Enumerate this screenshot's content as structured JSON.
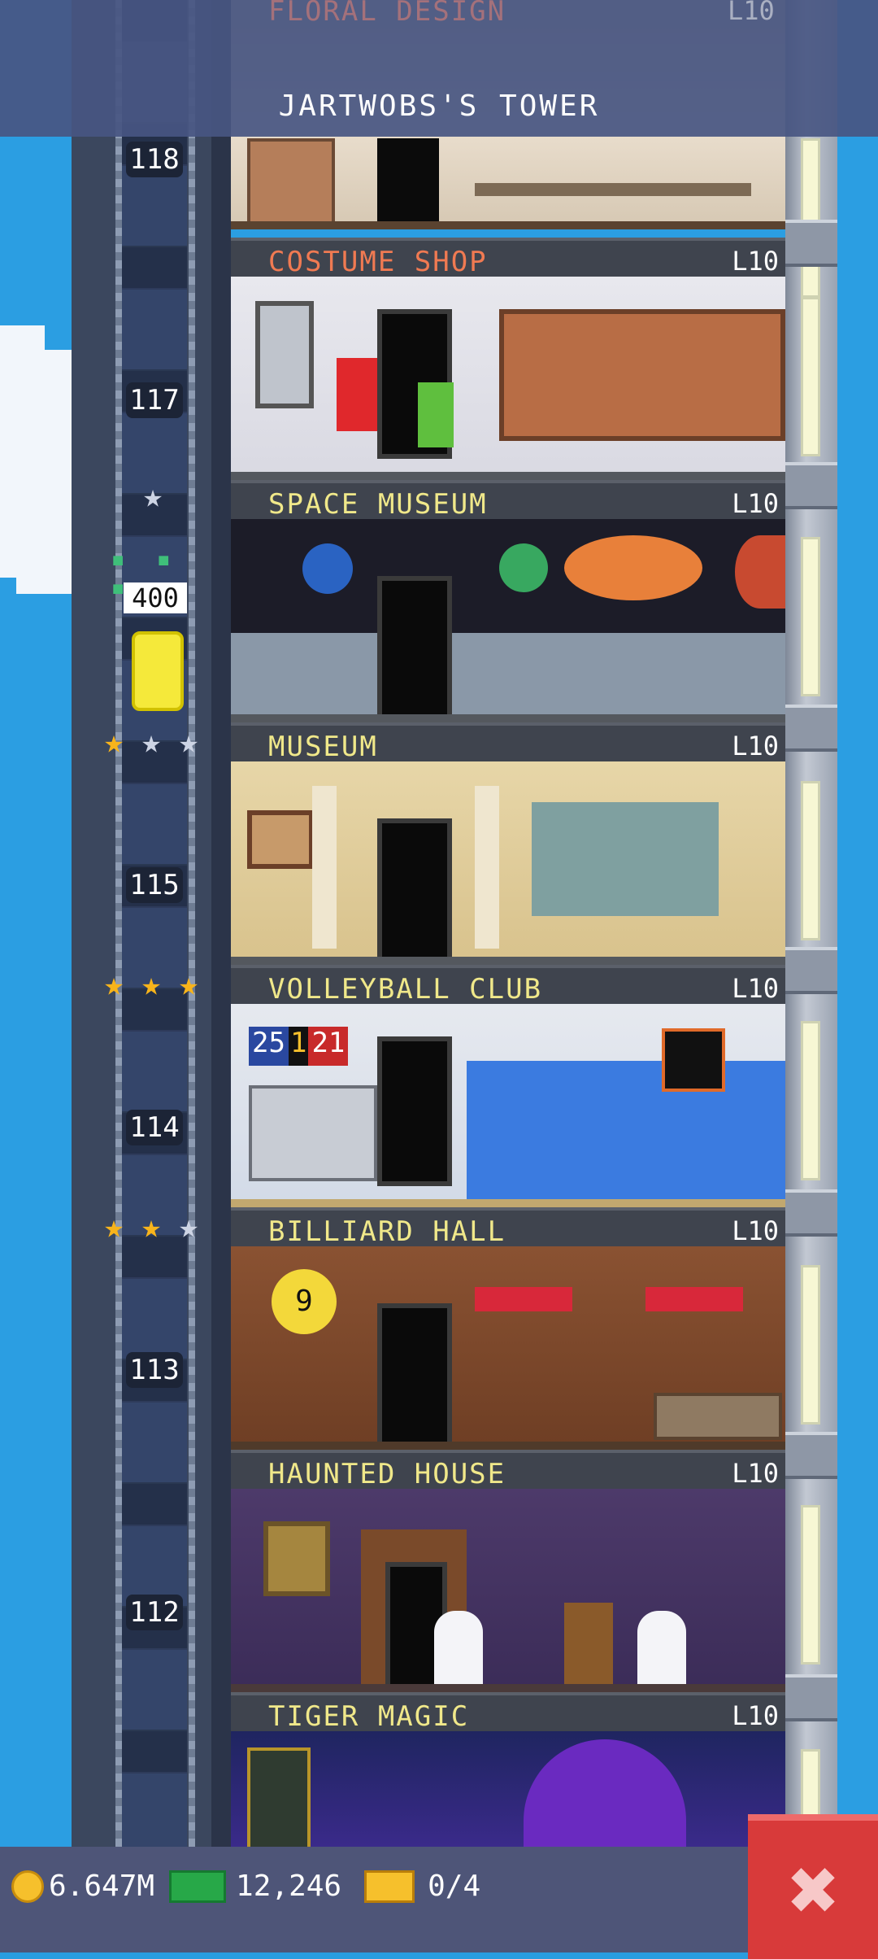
{
  "header": {
    "partial_floor_name": "FLORAL DESIGN",
    "partial_floor_level": "L10",
    "tower_title": "JARTWOBS'S TOWER"
  },
  "floors": [
    {
      "name": "COSTUME SHOP",
      "level": "L10",
      "number": "117",
      "name_color": "#f07a52"
    },
    {
      "name": "SPACE MUSEUM",
      "level": "L10",
      "number": "",
      "name_color": "#f0e88a"
    },
    {
      "name": "MUSEUM",
      "level": "L10",
      "number": "115",
      "name_color": "#f0e88a"
    },
    {
      "name": "VOLLEYBALL CLUB",
      "level": "L10",
      "number": "114",
      "name_color": "#f0e88a"
    },
    {
      "name": "BILLIARD HALL",
      "level": "L10",
      "number": "113",
      "name_color": "#f0e88a"
    },
    {
      "name": "HAUNTED HOUSE",
      "level": "L10",
      "number": "112",
      "name_color": "#f0e88a"
    },
    {
      "name": "TIGER MAGIC",
      "level": "L10",
      "number": "",
      "name_color": "#f0e88a"
    }
  ],
  "top_floor_number": "118",
  "elevator": {
    "passenger_count": "400"
  },
  "star_rows": [
    {
      "floor": "SPACE MUSEUM",
      "stars": [
        "silver"
      ]
    },
    {
      "floor": "MUSEUM",
      "stars": [
        "gold",
        "silver",
        "silver"
      ]
    },
    {
      "floor": "VOLLEYBALL CLUB",
      "stars": [
        "gold",
        "gold",
        "gold"
      ]
    },
    {
      "floor": "BILLIARD HALL",
      "stars": [
        "gold",
        "gold",
        "silver"
      ]
    }
  ],
  "volleyball_score": {
    "left": "25",
    "middle": "1",
    "right": "21"
  },
  "billiard_ball": "9",
  "status_bar": {
    "coins": "6.647M",
    "bux": "12,246",
    "tickets": "0/4"
  },
  "close_button": {
    "icon": "close-icon"
  },
  "colors": {
    "sky": "#2b9ee2",
    "header": "#485682",
    "close": "#d83a3a"
  }
}
